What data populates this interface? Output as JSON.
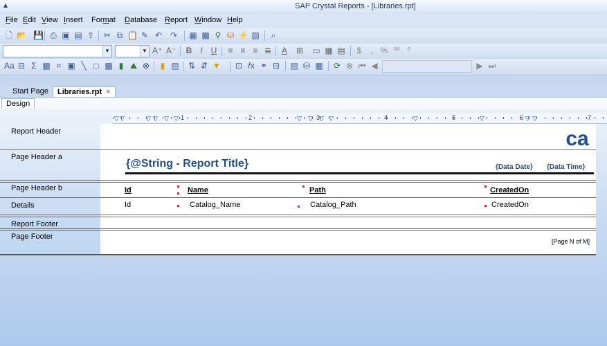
{
  "window": {
    "title": "SAP Crystal Reports - [Libraries.rpt]"
  },
  "menu": [
    "File",
    "Edit",
    "View",
    "Insert",
    "Format",
    "Database",
    "Report",
    "Window",
    "Help"
  ],
  "menu_access_keys": [
    "F",
    "E",
    "V",
    "I",
    "m",
    "D",
    "R",
    "W",
    "H"
  ],
  "tabs": {
    "start": "Start Page",
    "active": "Libraries.rpt",
    "close": "×"
  },
  "design_tab": "Design",
  "ruler": {
    "numbers": [
      "1",
      "2",
      "3",
      "4",
      "5",
      "6",
      "7"
    ]
  },
  "sections": {
    "report_header": "Report Header",
    "page_header_a": "Page Header a",
    "page_header_b": "Page Header b",
    "details": "Details",
    "report_footer": "Report Footer",
    "page_footer": "Page Footer"
  },
  "fields": {
    "report_title": "{@String - Report Title}",
    "data_date": "{Data Date}",
    "data_time": "{Data Time}",
    "col_id_header": "Id",
    "col_name_header": "Name",
    "col_path_header": "Path",
    "col_created_header": "CreatedOn",
    "detail_id": "Id",
    "detail_name": "Catalog_Name",
    "detail_path": "Catalog_Path",
    "detail_created": "CreatedOn",
    "page_n_of_m": "[Page N of M]"
  },
  "logo_text": "ca",
  "colors": {
    "accent": "#1f4e8c",
    "logo": "#1e4f9c",
    "workspace": "#c5d7ef"
  }
}
